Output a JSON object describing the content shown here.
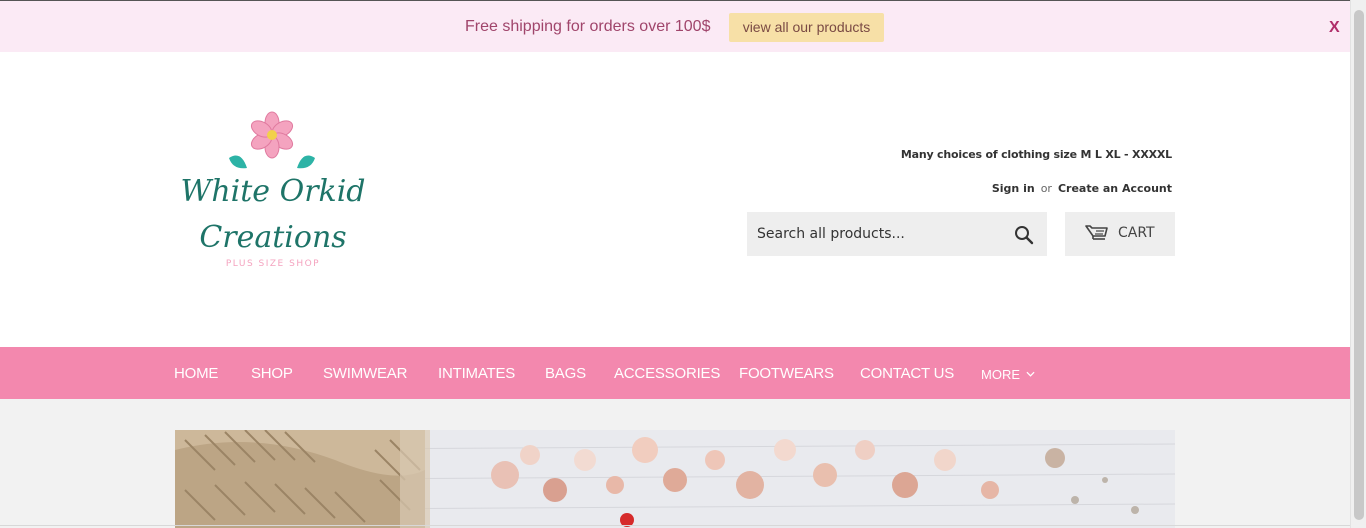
{
  "announcement": {
    "text": "Free shipping for orders over 100$",
    "button_label": "view all our products",
    "close_label": "X"
  },
  "header": {
    "logo": {
      "line1": "White Orkid",
      "line2": "Creations",
      "subtitle": "PLUS SIZE SHOP"
    },
    "tagline": "Many choices of clothing size M L XL - XXXXL",
    "sign_in": "Sign in",
    "or": "or",
    "create_account": "Create an Account",
    "search": {
      "placeholder": "Search all products..."
    },
    "cart_label": "CART"
  },
  "nav": {
    "items": [
      "HOME",
      "SHOP",
      "SWIMWEAR",
      "INTIMATES",
      "BAGS",
      "ACCESSORIES",
      "FOOTWEARS",
      "CONTACT US"
    ],
    "more": "MORE"
  },
  "icons": {
    "search": "search-icon",
    "cart": "cart-icon",
    "more": "chevron-down-icon"
  },
  "colors": {
    "announce_bg": "#fbeaf5",
    "nav_bg": "#f388ae",
    "announce_button": "#f7e0a7",
    "brand_teal": "#1e7468"
  }
}
